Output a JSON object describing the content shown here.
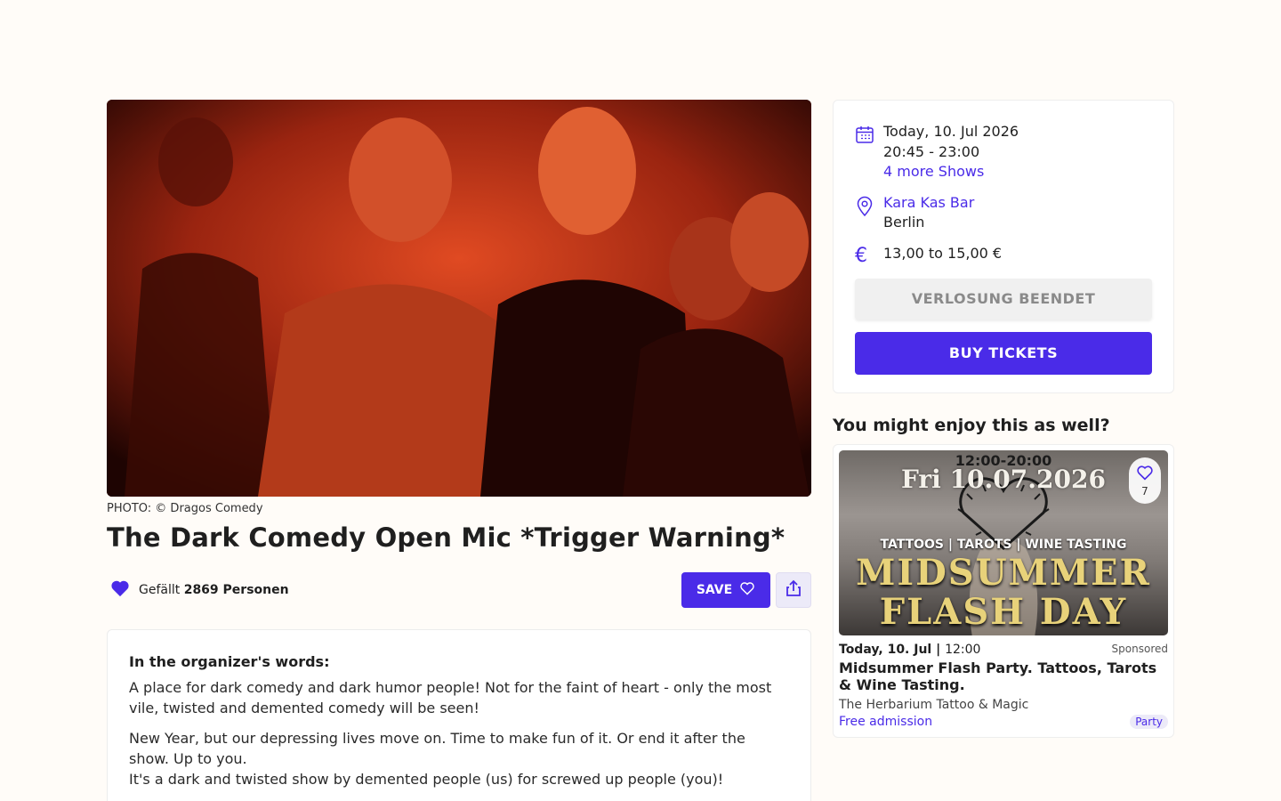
{
  "event": {
    "photo_credit": "PHOTO: © Dragos Comedy",
    "title": "The Dark Comedy Open Mic *Trigger Warning*",
    "likes_prefix": "Gefällt",
    "likes_count": "2869 Personen",
    "save_label": "SAVE",
    "description": {
      "heading": "In the organizer's words:",
      "paragraph1": "A place for dark comedy and dark humor people! Not for the faint of heart - only the most vile, twisted and demented comedy will be seen!",
      "paragraph2a": "New Year, but our depressing lives move on. Time to make fun of it. Or end it after the show. Up to you.",
      "paragraph2b": "It's a dark and twisted show by demented people (us) for screwed up people (you)!"
    }
  },
  "info": {
    "date": "Today, 10. Jul 2026",
    "time": "20:45 - 23:00",
    "more_shows": "4 more Shows",
    "venue": "Kara Kas Bar",
    "city": "Berlin",
    "currency_symbol": "€",
    "price": "13,00 to 15,00 €",
    "raffle_label": "VERLOSUNG BEENDET",
    "buy_label": "BUY TICKETS"
  },
  "recommendations": {
    "title": "You might enjoy this as well?",
    "items": [
      {
        "image_time": "12:00-20:00",
        "image_date": "Fri 10.07.2026",
        "image_subtitle": "TATTOOS | TAROTS | WINE TASTING",
        "image_headline1": "MIDSUMMER",
        "image_headline2": "FLASH DAY",
        "fav_count": "7",
        "date": "Today, 10. Jul",
        "separator": " | ",
        "time": "12:00",
        "sponsored": "Sponsored",
        "name": "Midsummer Flash Party. Tattoos, Tarots & Wine Tasting.",
        "venue": "The Herbarium Tattoo & Magic",
        "price": "Free admission",
        "tag": "Party"
      }
    ]
  },
  "colors": {
    "accent": "#4a2be8",
    "background": "#fffcf8"
  }
}
